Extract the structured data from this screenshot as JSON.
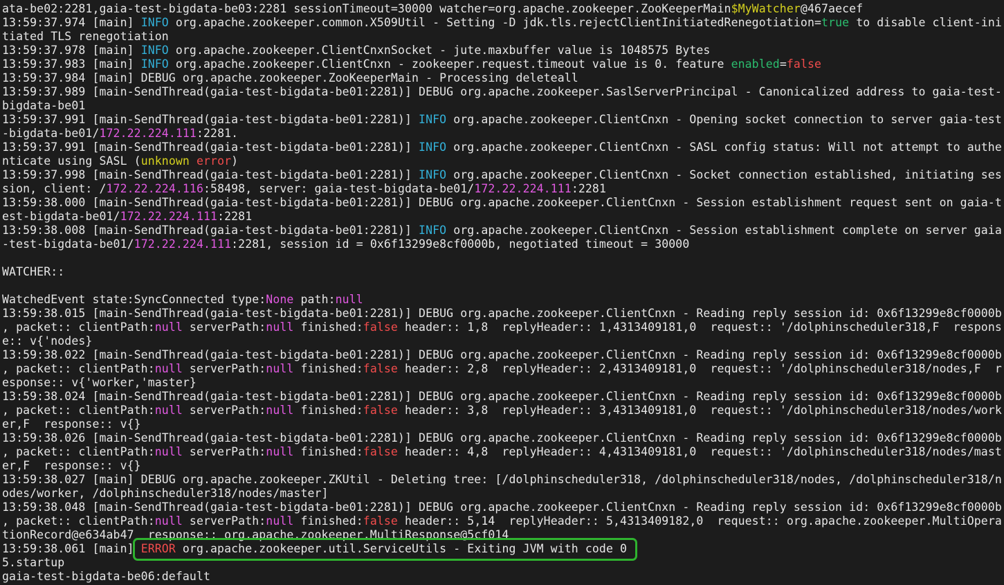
{
  "app": {
    "type": "terminal-log",
    "description": "ZooKeeper client session deleteall log output"
  },
  "colors": {
    "background": "#1c1c1c",
    "d": "#e6e6e6",
    "i": "#33b0d8",
    "e": "#f14c4c",
    "y": "#d6d21f",
    "g": "#2bbd6e",
    "m": "#e25ae2",
    "box": "#2fb32f"
  },
  "annotation_box": {
    "highlighted_text": "ERROR org.apache.zookeeper.util.ServiceUtils - Exiting JVM with code 0",
    "color": "#2fb32f"
  },
  "terminal": {
    "lines": [
      {
        "segments": [
          {
            "t": "ata-be02:2281,gaia-test-bigdata-be03:2281 sessionTimeout=30000 watcher=org.apache.zookeeper.ZooKeeperMain",
            "c": "d"
          },
          {
            "t": "$MyWatcher",
            "c": "y"
          },
          {
            "t": "@467aecef",
            "c": "d"
          }
        ]
      },
      {
        "segments": [
          {
            "t": "13:59:37.974 [main] ",
            "c": "d"
          },
          {
            "t": "INFO",
            "c": "i"
          },
          {
            "t": " org.apache.zookeeper.common.X509Util - Setting -D jdk.tls.rejectClientInitiatedRenegotiation=",
            "c": "d"
          },
          {
            "t": "true",
            "c": "g"
          },
          {
            "t": " to disable client-ini",
            "c": "d"
          }
        ]
      },
      {
        "segments": [
          {
            "t": "tiated TLS renegotiation",
            "c": "d"
          }
        ]
      },
      {
        "segments": [
          {
            "t": "13:59:37.978 [main] ",
            "c": "d"
          },
          {
            "t": "INFO",
            "c": "i"
          },
          {
            "t": " org.apache.zookeeper.ClientCnxnSocket - jute.maxbuffer value is 1048575 Bytes",
            "c": "d"
          }
        ]
      },
      {
        "segments": [
          {
            "t": "13:59:37.983 [main] ",
            "c": "d"
          },
          {
            "t": "INFO",
            "c": "i"
          },
          {
            "t": " org.apache.zookeeper.ClientCnxn - zookeeper.request.timeout value is 0. feature ",
            "c": "d"
          },
          {
            "t": "enabled",
            "c": "g"
          },
          {
            "t": "=",
            "c": "d"
          },
          {
            "t": "false",
            "c": "e"
          }
        ]
      },
      {
        "segments": [
          {
            "t": "13:59:37.984 [main] DEBUG org.apache.zookeeper.ZooKeeperMain - Processing deleteall",
            "c": "d"
          }
        ]
      },
      {
        "segments": [
          {
            "t": "13:59:37.989 [main-SendThread(gaia-test-bigdata-be01:2281)] DEBUG org.apache.zookeeper.SaslServerPrincipal - Canonicalized address to gaia-test-",
            "c": "d"
          }
        ]
      },
      {
        "segments": [
          {
            "t": "bigdata-be01",
            "c": "d"
          }
        ]
      },
      {
        "segments": [
          {
            "t": "13:59:37.991 [main-SendThread(gaia-test-bigdata-be01:2281)] ",
            "c": "d"
          },
          {
            "t": "INFO",
            "c": "i"
          },
          {
            "t": " org.apache.zookeeper.ClientCnxn - Opening socket connection to server gaia-test",
            "c": "d"
          }
        ]
      },
      {
        "segments": [
          {
            "t": "-bigdata-be01/",
            "c": "d"
          },
          {
            "t": "172.22.224.111",
            "c": "m"
          },
          {
            "t": ":2281.",
            "c": "d"
          }
        ]
      },
      {
        "segments": [
          {
            "t": "13:59:37.991 [main-SendThread(gaia-test-bigdata-be01:2281)] ",
            "c": "d"
          },
          {
            "t": "INFO",
            "c": "i"
          },
          {
            "t": " org.apache.zookeeper.ClientCnxn - SASL config status: Will not attempt to authe",
            "c": "d"
          }
        ]
      },
      {
        "segments": [
          {
            "t": "nticate using SASL (",
            "c": "d"
          },
          {
            "t": "unknown",
            "c": "y"
          },
          {
            "t": " ",
            "c": "d"
          },
          {
            "t": "error",
            "c": "e"
          },
          {
            "t": ")",
            "c": "d"
          }
        ]
      },
      {
        "segments": [
          {
            "t": "13:59:37.998 [main-SendThread(gaia-test-bigdata-be01:2281)] ",
            "c": "d"
          },
          {
            "t": "INFO",
            "c": "i"
          },
          {
            "t": " org.apache.zookeeper.ClientCnxn - Socket connection established, initiating ses",
            "c": "d"
          }
        ]
      },
      {
        "segments": [
          {
            "t": "sion, client: /",
            "c": "d"
          },
          {
            "t": "172.22.224.116",
            "c": "m"
          },
          {
            "t": ":58498, server: gaia-test-bigdata-be01/",
            "c": "d"
          },
          {
            "t": "172.22.224.111",
            "c": "m"
          },
          {
            "t": ":2281",
            "c": "d"
          }
        ]
      },
      {
        "segments": [
          {
            "t": "13:59:38.000 [main-SendThread(gaia-test-bigdata-be01:2281)] DEBUG org.apache.zookeeper.ClientCnxn - Session establishment request sent on gaia-t",
            "c": "d"
          }
        ]
      },
      {
        "segments": [
          {
            "t": "est-bigdata-be01/",
            "c": "d"
          },
          {
            "t": "172.22.224.111",
            "c": "m"
          },
          {
            "t": ":2281",
            "c": "d"
          }
        ]
      },
      {
        "segments": [
          {
            "t": "13:59:38.008 [main-SendThread(gaia-test-bigdata-be01:2281)] ",
            "c": "d"
          },
          {
            "t": "INFO",
            "c": "i"
          },
          {
            "t": " org.apache.zookeeper.ClientCnxn - Session establishment complete on server gaia",
            "c": "d"
          }
        ]
      },
      {
        "segments": [
          {
            "t": "-test-bigdata-be01/",
            "c": "d"
          },
          {
            "t": "172.22.224.111",
            "c": "m"
          },
          {
            "t": ":2281, session id = 0x6f13299e8cf0000b, negotiated timeout = 30000",
            "c": "d"
          }
        ]
      },
      {
        "segments": []
      },
      {
        "segments": [
          {
            "t": "WATCHER::",
            "c": "d"
          }
        ]
      },
      {
        "segments": []
      },
      {
        "segments": [
          {
            "t": "WatchedEvent state:SyncConnected type:",
            "c": "d"
          },
          {
            "t": "None",
            "c": "m"
          },
          {
            "t": " path:",
            "c": "d"
          },
          {
            "t": "null",
            "c": "m"
          }
        ]
      },
      {
        "segments": [
          {
            "t": "13:59:38.015 [main-SendThread(gaia-test-bigdata-be01:2281)] DEBUG org.apache.zookeeper.ClientCnxn - Reading reply session id: 0x6f13299e8cf0000b",
            "c": "d"
          }
        ]
      },
      {
        "segments": [
          {
            "t": ", packet:: clientPath:",
            "c": "d"
          },
          {
            "t": "null",
            "c": "m"
          },
          {
            "t": " serverPath:",
            "c": "d"
          },
          {
            "t": "null",
            "c": "m"
          },
          {
            "t": " finished:",
            "c": "d"
          },
          {
            "t": "false",
            "c": "e"
          },
          {
            "t": " header:: 1,8  replyHeader:: 1,4313409181,0  request:: '/dolphinscheduler318,F  respons",
            "c": "d"
          }
        ]
      },
      {
        "segments": [
          {
            "t": "e:: v{'nodes}",
            "c": "d"
          }
        ]
      },
      {
        "segments": [
          {
            "t": "13:59:38.022 [main-SendThread(gaia-test-bigdata-be01:2281)] DEBUG org.apache.zookeeper.ClientCnxn - Reading reply session id: 0x6f13299e8cf0000b",
            "c": "d"
          }
        ]
      },
      {
        "segments": [
          {
            "t": ", packet:: clientPath:",
            "c": "d"
          },
          {
            "t": "null",
            "c": "m"
          },
          {
            "t": " serverPath:",
            "c": "d"
          },
          {
            "t": "null",
            "c": "m"
          },
          {
            "t": " finished:",
            "c": "d"
          },
          {
            "t": "false",
            "c": "e"
          },
          {
            "t": " header:: 2,8  replyHeader:: 2,4313409181,0  request:: '/dolphinscheduler318/nodes,F  r",
            "c": "d"
          }
        ]
      },
      {
        "segments": [
          {
            "t": "esponse:: v{'worker,'master}",
            "c": "d"
          }
        ]
      },
      {
        "segments": [
          {
            "t": "13:59:38.024 [main-SendThread(gaia-test-bigdata-be01:2281)] DEBUG org.apache.zookeeper.ClientCnxn - Reading reply session id: 0x6f13299e8cf0000b",
            "c": "d"
          }
        ]
      },
      {
        "segments": [
          {
            "t": ", packet:: clientPath:",
            "c": "d"
          },
          {
            "t": "null",
            "c": "m"
          },
          {
            "t": " serverPath:",
            "c": "d"
          },
          {
            "t": "null",
            "c": "m"
          },
          {
            "t": " finished:",
            "c": "d"
          },
          {
            "t": "false",
            "c": "e"
          },
          {
            "t": " header:: 3,8  replyHeader:: 3,4313409181,0  request:: '/dolphinscheduler318/nodes/work",
            "c": "d"
          }
        ]
      },
      {
        "segments": [
          {
            "t": "er,F  response:: v{}",
            "c": "d"
          }
        ]
      },
      {
        "segments": [
          {
            "t": "13:59:38.026 [main-SendThread(gaia-test-bigdata-be01:2281)] DEBUG org.apache.zookeeper.ClientCnxn - Reading reply session id: 0x6f13299e8cf0000b",
            "c": "d"
          }
        ]
      },
      {
        "segments": [
          {
            "t": ", packet:: clientPath:",
            "c": "d"
          },
          {
            "t": "null",
            "c": "m"
          },
          {
            "t": " serverPath:",
            "c": "d"
          },
          {
            "t": "null",
            "c": "m"
          },
          {
            "t": " finished:",
            "c": "d"
          },
          {
            "t": "false",
            "c": "e"
          },
          {
            "t": " header:: 4,8  replyHeader:: 4,4313409181,0  request:: '/dolphinscheduler318/nodes/mast",
            "c": "d"
          }
        ]
      },
      {
        "segments": [
          {
            "t": "er,F  response:: v{}",
            "c": "d"
          }
        ]
      },
      {
        "segments": [
          {
            "t": "13:59:38.027 [main] DEBUG org.apache.zookeeper.ZKUtil - Deleting tree: [/dolphinscheduler318, /dolphinscheduler318/nodes, /dolphinscheduler318/n",
            "c": "d"
          }
        ]
      },
      {
        "segments": [
          {
            "t": "odes/worker, /dolphinscheduler318/nodes/master]",
            "c": "d"
          }
        ]
      },
      {
        "segments": [
          {
            "t": "13:59:38.048 [main-SendThread(gaia-test-bigdata-be01:2281)] DEBUG org.apache.zookeeper.ClientCnxn - Reading reply session id: 0x6f13299e8cf0000b",
            "c": "d"
          }
        ]
      },
      {
        "segments": [
          {
            "t": ", packet:: clientPath:",
            "c": "d"
          },
          {
            "t": "null",
            "c": "m"
          },
          {
            "t": " serverPath:",
            "c": "d"
          },
          {
            "t": "null",
            "c": "m"
          },
          {
            "t": " finished:",
            "c": "d"
          },
          {
            "t": "false",
            "c": "e"
          },
          {
            "t": " header:: 5,14  replyHeader:: 5,4313409182,0  request:: org.apache.zookeeper.MultiOpera",
            "c": "d"
          }
        ]
      },
      {
        "segments": [
          {
            "t": "tionRecord@e634ab47  response:: org.apache.zookeeper.MultiResponse@5cf014",
            "c": "d"
          }
        ]
      },
      {
        "segments": [
          {
            "t": "13:59:38.061 [main] ",
            "c": "d"
          },
          {
            "t": "ERROR",
            "c": "e"
          },
          {
            "t": " org.apache.zookeeper.util.ServiceUtils - Exiting JVM with code 0",
            "c": "d"
          }
        ]
      },
      {
        "segments": [
          {
            "t": "5.startup",
            "c": "d"
          }
        ]
      },
      {
        "segments": [
          {
            "t": "gaia-test-bigdata-be06:default",
            "c": "d"
          }
        ]
      }
    ]
  }
}
